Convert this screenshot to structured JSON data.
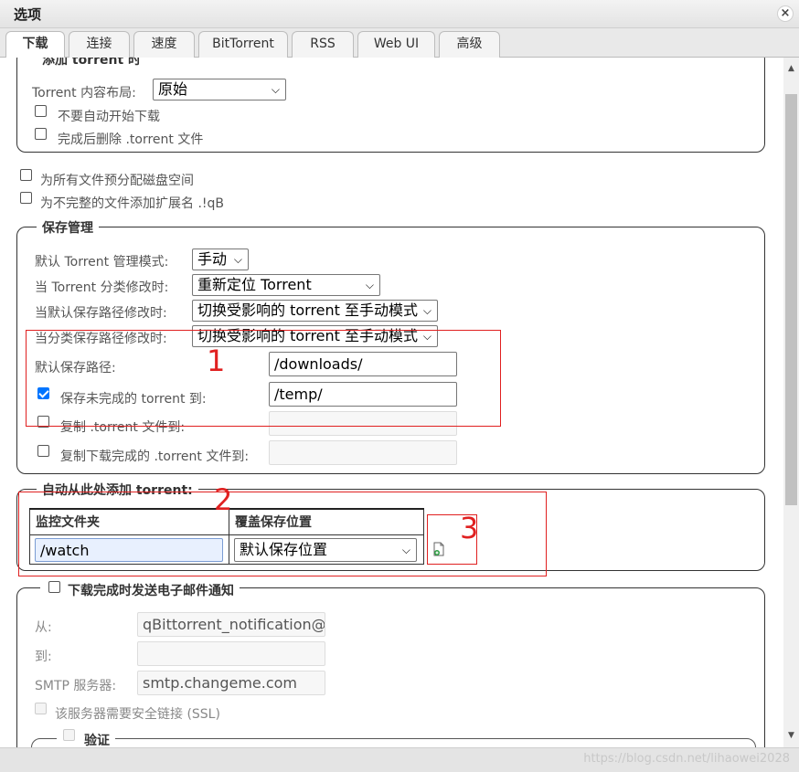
{
  "window": {
    "title": "选项",
    "close_glyph": "×"
  },
  "tabs": [
    {
      "label": "下载",
      "active": true
    },
    {
      "label": "连接"
    },
    {
      "label": "速度"
    },
    {
      "label": "BitTorrent"
    },
    {
      "label": "RSS"
    },
    {
      "label": "Web UI"
    },
    {
      "label": "高级"
    }
  ],
  "add_torrent": {
    "legend": "添加 torrent 时",
    "layout_label": "Torrent 内容布局:",
    "layout_value": "原始",
    "no_autostart_label": "不要自动开始下载",
    "delete_torrent_label": "完成后删除 .torrent 文件"
  },
  "preallocate_label": "为所有文件预分配磁盘空间",
  "append_ext_label": "为不完整的文件添加扩展名 .!qB",
  "saving": {
    "legend": "保存管理",
    "mode_label": "默认 Torrent 管理模式:",
    "mode_value": "手动",
    "category_changed_label": "当 Torrent 分类修改时:",
    "category_changed_value": "重新定位 Torrent",
    "default_path_changed_label": "当默认保存路径修改时:",
    "default_path_changed_value": "切换受影响的 torrent 至手动模式",
    "category_path_changed_label": "当分类保存路径修改时:",
    "category_path_changed_value": "切换受影响的 torrent 至手动模式",
    "default_save_path_label": "默认保存路径:",
    "default_save_path_value": "/downloads/",
    "temp_path_label": "保存未完成的 torrent 到:",
    "temp_path_value": "/temp/",
    "temp_path_enabled": true,
    "copy_torrent_label": "复制 .torrent 文件到:",
    "copy_finished_label": "复制下载完成的 .torrent 文件到:"
  },
  "watch": {
    "legend": "自动从此处添加 torrent:",
    "col_folder": "监控文件夹",
    "col_override": "覆盖保存位置",
    "folder_value": "/watch",
    "override_value": "默认保存位置"
  },
  "email": {
    "legend": "下载完成时发送电子邮件通知",
    "from_label": "从:",
    "from_value": "qBittorrent_notification@ex",
    "to_label": "到:",
    "to_value": "",
    "smtp_label": "SMTP 服务器:",
    "smtp_value": "smtp.changeme.com",
    "ssl_label": "该服务器需要安全链接 (SSL)",
    "auth_legend": "验证"
  },
  "annotations": [
    "1",
    "2",
    "3"
  ],
  "watermark": "https://blog.csdn.net/lihaowei2028",
  "icons": {
    "add_row": "add-file-icon",
    "close": "close-icon"
  }
}
